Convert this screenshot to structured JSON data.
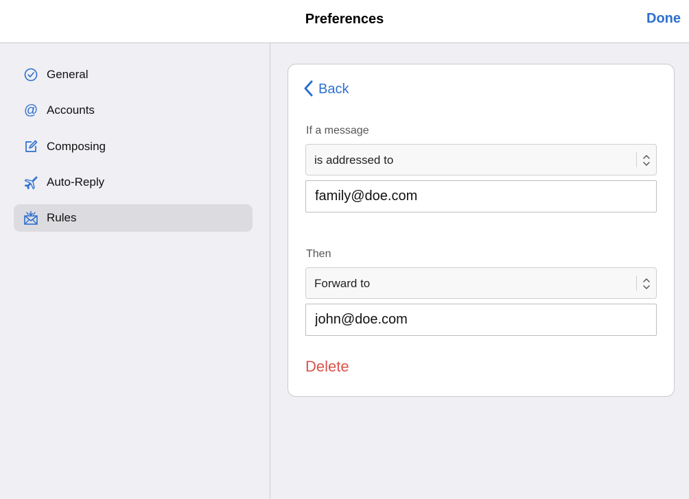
{
  "header": {
    "title": "Preferences",
    "done_label": "Done"
  },
  "sidebar": {
    "items": [
      {
        "label": "General",
        "icon": "checkmark-circle-icon"
      },
      {
        "label": "Accounts",
        "icon": "at-sign-icon"
      },
      {
        "label": "Composing",
        "icon": "compose-icon"
      },
      {
        "label": "Auto-Reply",
        "icon": "airplane-icon"
      },
      {
        "label": "Rules",
        "icon": "envelope-rules-icon",
        "selected": true
      }
    ]
  },
  "rule_editor": {
    "back_label": "Back",
    "condition_label": "If a message",
    "condition_select": "is addressed to",
    "condition_value": "family@doe.com",
    "action_label": "Then",
    "action_select": "Forward to",
    "action_value": "john@doe.com",
    "delete_label": "Delete"
  },
  "colors": {
    "accent": "#2d6fcf",
    "destructive": "#d9534a",
    "background": "#efeff4",
    "selected_row": "#dcdce0"
  }
}
